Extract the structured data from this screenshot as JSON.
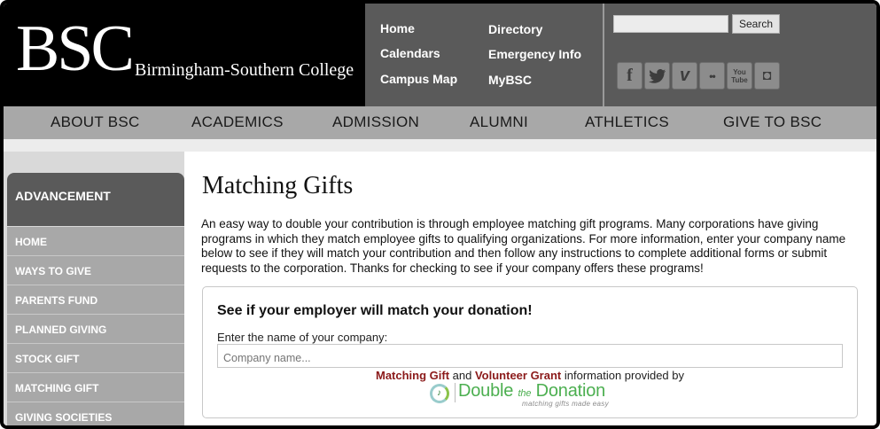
{
  "header": {
    "logo": {
      "mark": "BSC",
      "name": "Birmingham-Southern College"
    },
    "quick_links": [
      "Home",
      "Calendars",
      "Campus Map",
      "Directory",
      "Emergency Info",
      "MyBSC"
    ],
    "search": {
      "placeholder": "",
      "button": "Search"
    },
    "social": [
      {
        "icon": "facebook-icon",
        "glyph": "f"
      },
      {
        "icon": "twitter-icon",
        "glyph": "t"
      },
      {
        "icon": "vimeo-icon",
        "glyph": "v"
      },
      {
        "icon": "flickr-icon",
        "glyph": "••"
      },
      {
        "icon": "youtube-icon",
        "glyph": "You\nTube"
      },
      {
        "icon": "instagram-icon",
        "glyph": "◘"
      }
    ]
  },
  "main_nav": [
    "ABOUT BSC",
    "ACADEMICS",
    "ADMISSION",
    "ALUMNI",
    "ATHLETICS",
    "GIVE TO BSC"
  ],
  "sidebar": {
    "heading": "ADVANCEMENT",
    "items": [
      "HOME",
      "WAYS TO GIVE",
      "PARENTS FUND",
      "PLANNED GIVING",
      "STOCK GIFT",
      "MATCHING GIFT",
      "GIVING SOCIETIES"
    ]
  },
  "content": {
    "title": "Matching Gifts",
    "intro": "An easy way to double your contribution is through employee matching gift programs. Many corporations have giving programs in which they match employee gifts to qualifying organizations. For more information, enter your company name below to see if they will match your contribution and then follow any instructions to complete additional forms or submit requests to the corporation. Thanks for checking to see if your company offers these programs!"
  },
  "matching_box": {
    "heading": "See if your employer will match your donation!",
    "label": "Enter the name of your company:",
    "placeholder": "Company name...",
    "link1": "Matching Gift",
    "and_text": " and ",
    "link2": "Volunteer Grant",
    "provided_text": " information provided by",
    "brand_double": "Double",
    "brand_the": "the",
    "brand_donation": "Donation",
    "brand_tagline": "matching gifts made easy"
  },
  "colors": {
    "header_black": "#000000",
    "header_gray": "#5a5a5a",
    "nav_gray": "#a8a8a8",
    "link_red": "#8b1a1a",
    "brand_green": "#4caf50"
  }
}
